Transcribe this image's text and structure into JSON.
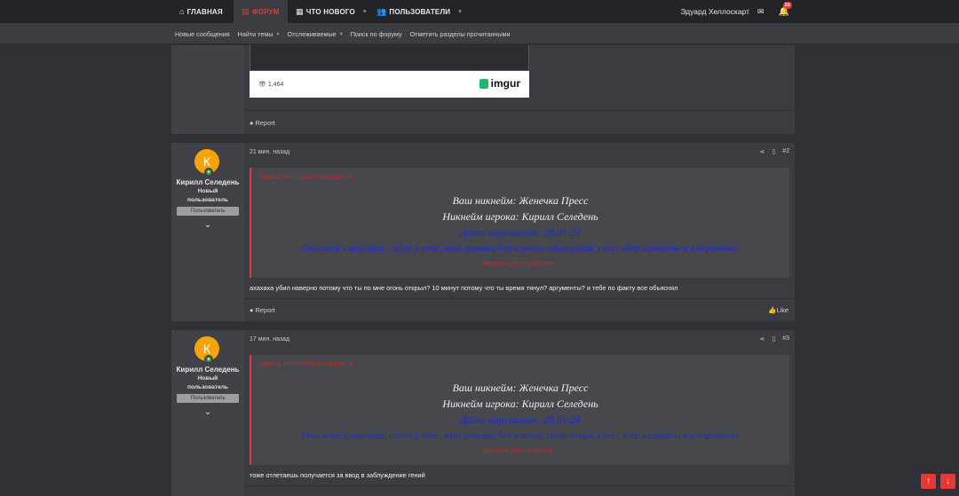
{
  "nav": {
    "tabs": [
      {
        "label": "ГЛАВНАЯ",
        "icon": "home-icon"
      },
      {
        "label": "ФОРУМ",
        "icon": "forum-icon"
      },
      {
        "label": "ЧТО НОВОГО",
        "icon": "news-icon"
      },
      {
        "label": "ПОЛЬЗОВАТЕЛИ",
        "icon": "users-icon"
      }
    ],
    "username": "Эдуард Хеллоскарт",
    "notification_count": "16"
  },
  "subnav": {
    "items": [
      "Новые сообщения",
      "Найти темы",
      "Отслеживаемые",
      "Поиск по форуму",
      "Отметить разделы прочитанными"
    ]
  },
  "prev_post": {
    "imgur_views": "1,464",
    "imgur_logo": "imgur",
    "report_label": "Report"
  },
  "posts": [
    {
      "time": "21 мин. назад",
      "number": "#2",
      "avatar_letter": "К",
      "username": "Кирилл Селедень",
      "title_line1": "Новый",
      "title_line2": "пользователь",
      "banner": "Пользователь",
      "quote_author": "Эдуард Хеллоскарт сказал(а):",
      "quote_lines": [
        "Ваш никнейм: Женечка Пресс",
        "Никнейм игрока: Кирилл Селедень",
        "Дата нарушения: 28.01.24",
        "Описание ситуации: сидел у ттс, взял повозил без всякого объяснения, стал эдержаиваться в корчиннах",
        "Нажмите для раскрытия..."
      ],
      "message": "ахахаха убил наверно потому что ты по мне огонь открыл? 10 минут потому что ты время тянул? аргументы? я тебе по факту все обьяснял",
      "report_label": "Report",
      "like_label": "Like"
    },
    {
      "time": "17 мин. назад",
      "number": "#3",
      "avatar_letter": "К",
      "username": "Кирилл Селедень",
      "title_line1": "Новый",
      "title_line2": "пользователь",
      "banner": "Пользователь",
      "quote_author": "Эдуард Хеллоскарт сказал(а):",
      "quote_lines": [
        "Ваш никнейм: Женечка Пресс",
        "Никнейм игрока: Кирилл Селедень",
        "Дата нарушения: 28.01.24",
        "Описание ситуации: сидел у ттс, взял повозил без всякого объяснения, стал эдержаиваться в корчиннах",
        "Нажмите для раскрытия..."
      ],
      "message": "тоже отлетаешь получается за ввод в заблуждение гений"
    }
  ],
  "colors": {
    "accent": "#e53935",
    "background": "#2f3136",
    "post_bg": "#3a3c41",
    "avatar": "#f5a30b"
  }
}
